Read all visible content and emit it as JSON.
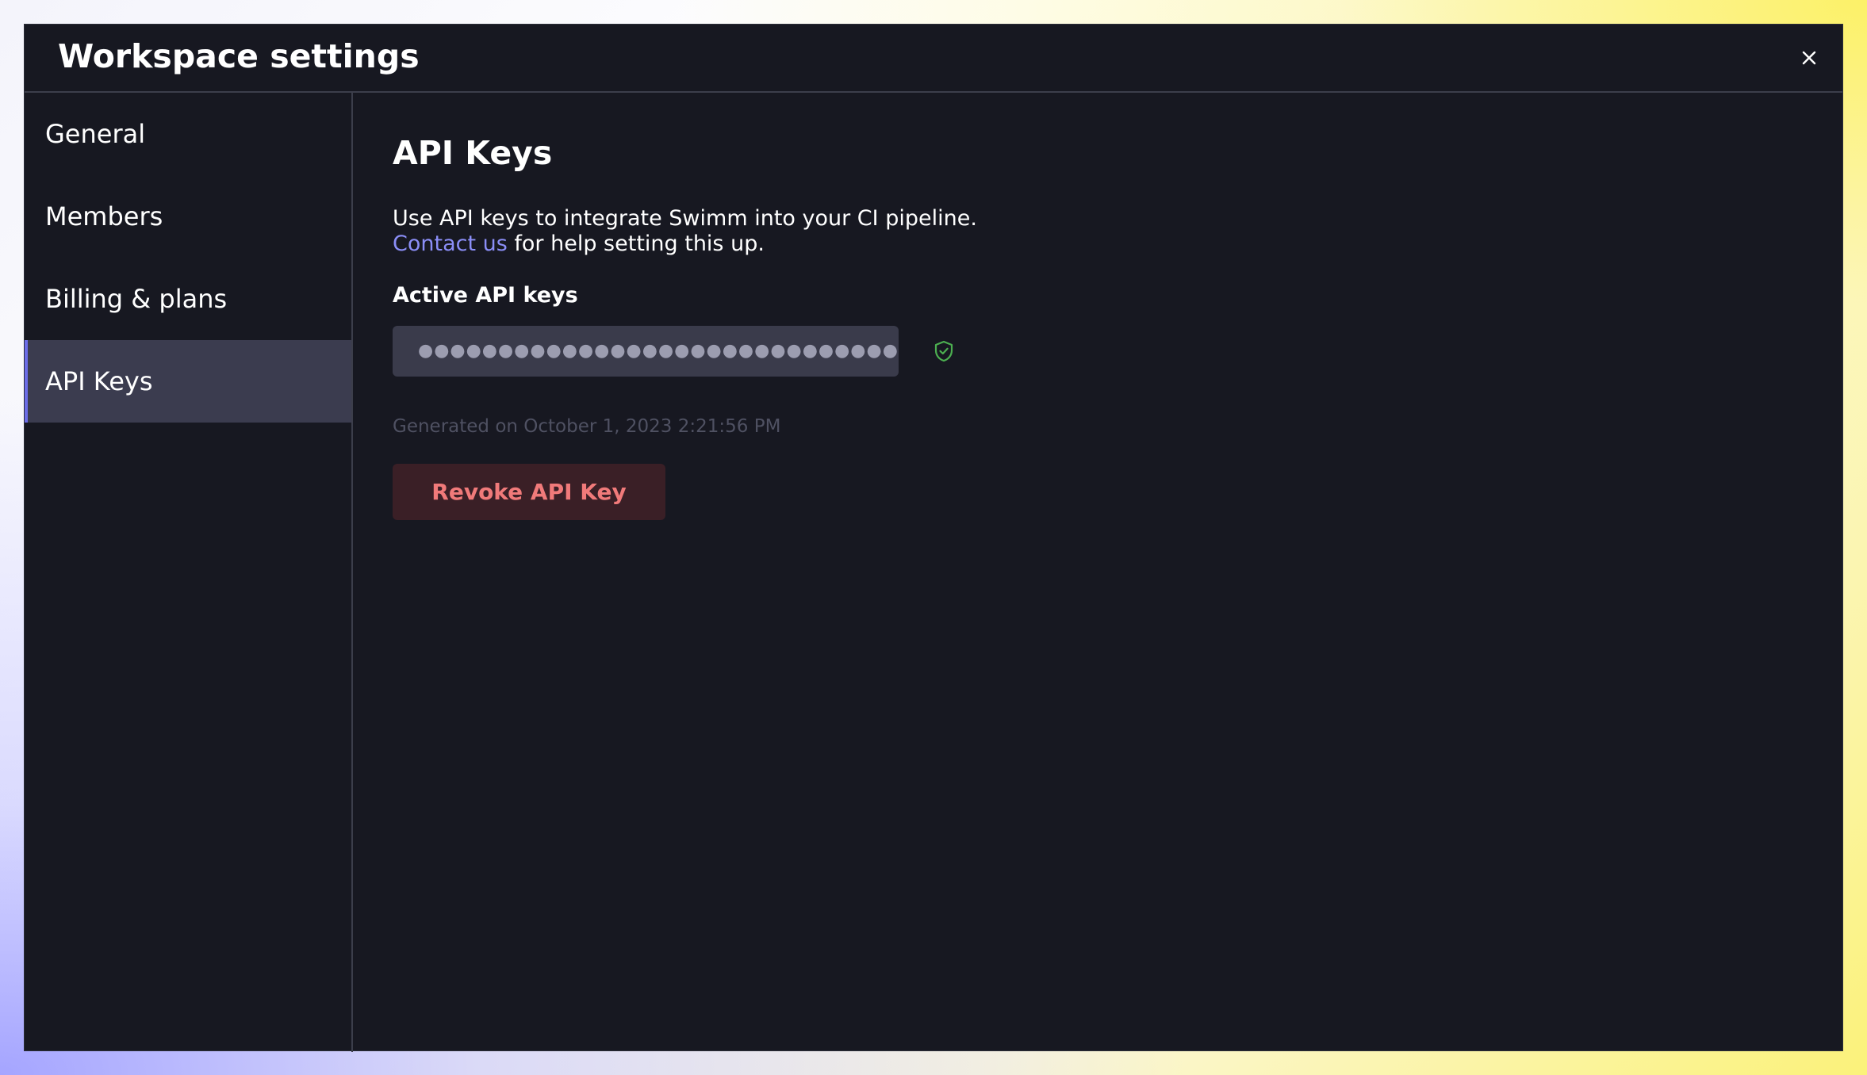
{
  "window": {
    "title": "Workspace settings",
    "close_icon": "close-icon"
  },
  "sidebar": {
    "items": [
      {
        "label": "General",
        "active": false
      },
      {
        "label": "Members",
        "active": false
      },
      {
        "label": "Billing & plans",
        "active": false
      },
      {
        "label": "API Keys",
        "active": true
      }
    ]
  },
  "main": {
    "title": "API Keys",
    "description_line1": "Use API keys to integrate Swimm into your CI pipeline.",
    "contact_link": "Contact us",
    "description_line2_rest": " for help setting this up.",
    "active_keys_heading": "Active API keys",
    "api_key_masked": "●●●●●●●●●●●●●●●●●●●●●●●●●●●●●●●●●",
    "shield_icon": "shield-check-icon",
    "generated_text": "Generated on October 1, 2023 2:21:56 PM",
    "revoke_label": "Revoke API Key"
  },
  "colors": {
    "background": "#171821",
    "active_item": "#3b3c4f",
    "accent": "#6c6de8",
    "link": "#8b8ef7",
    "shield": "#4caf50",
    "danger_text": "#f07a7a",
    "danger_bg": "#3a1f26"
  }
}
